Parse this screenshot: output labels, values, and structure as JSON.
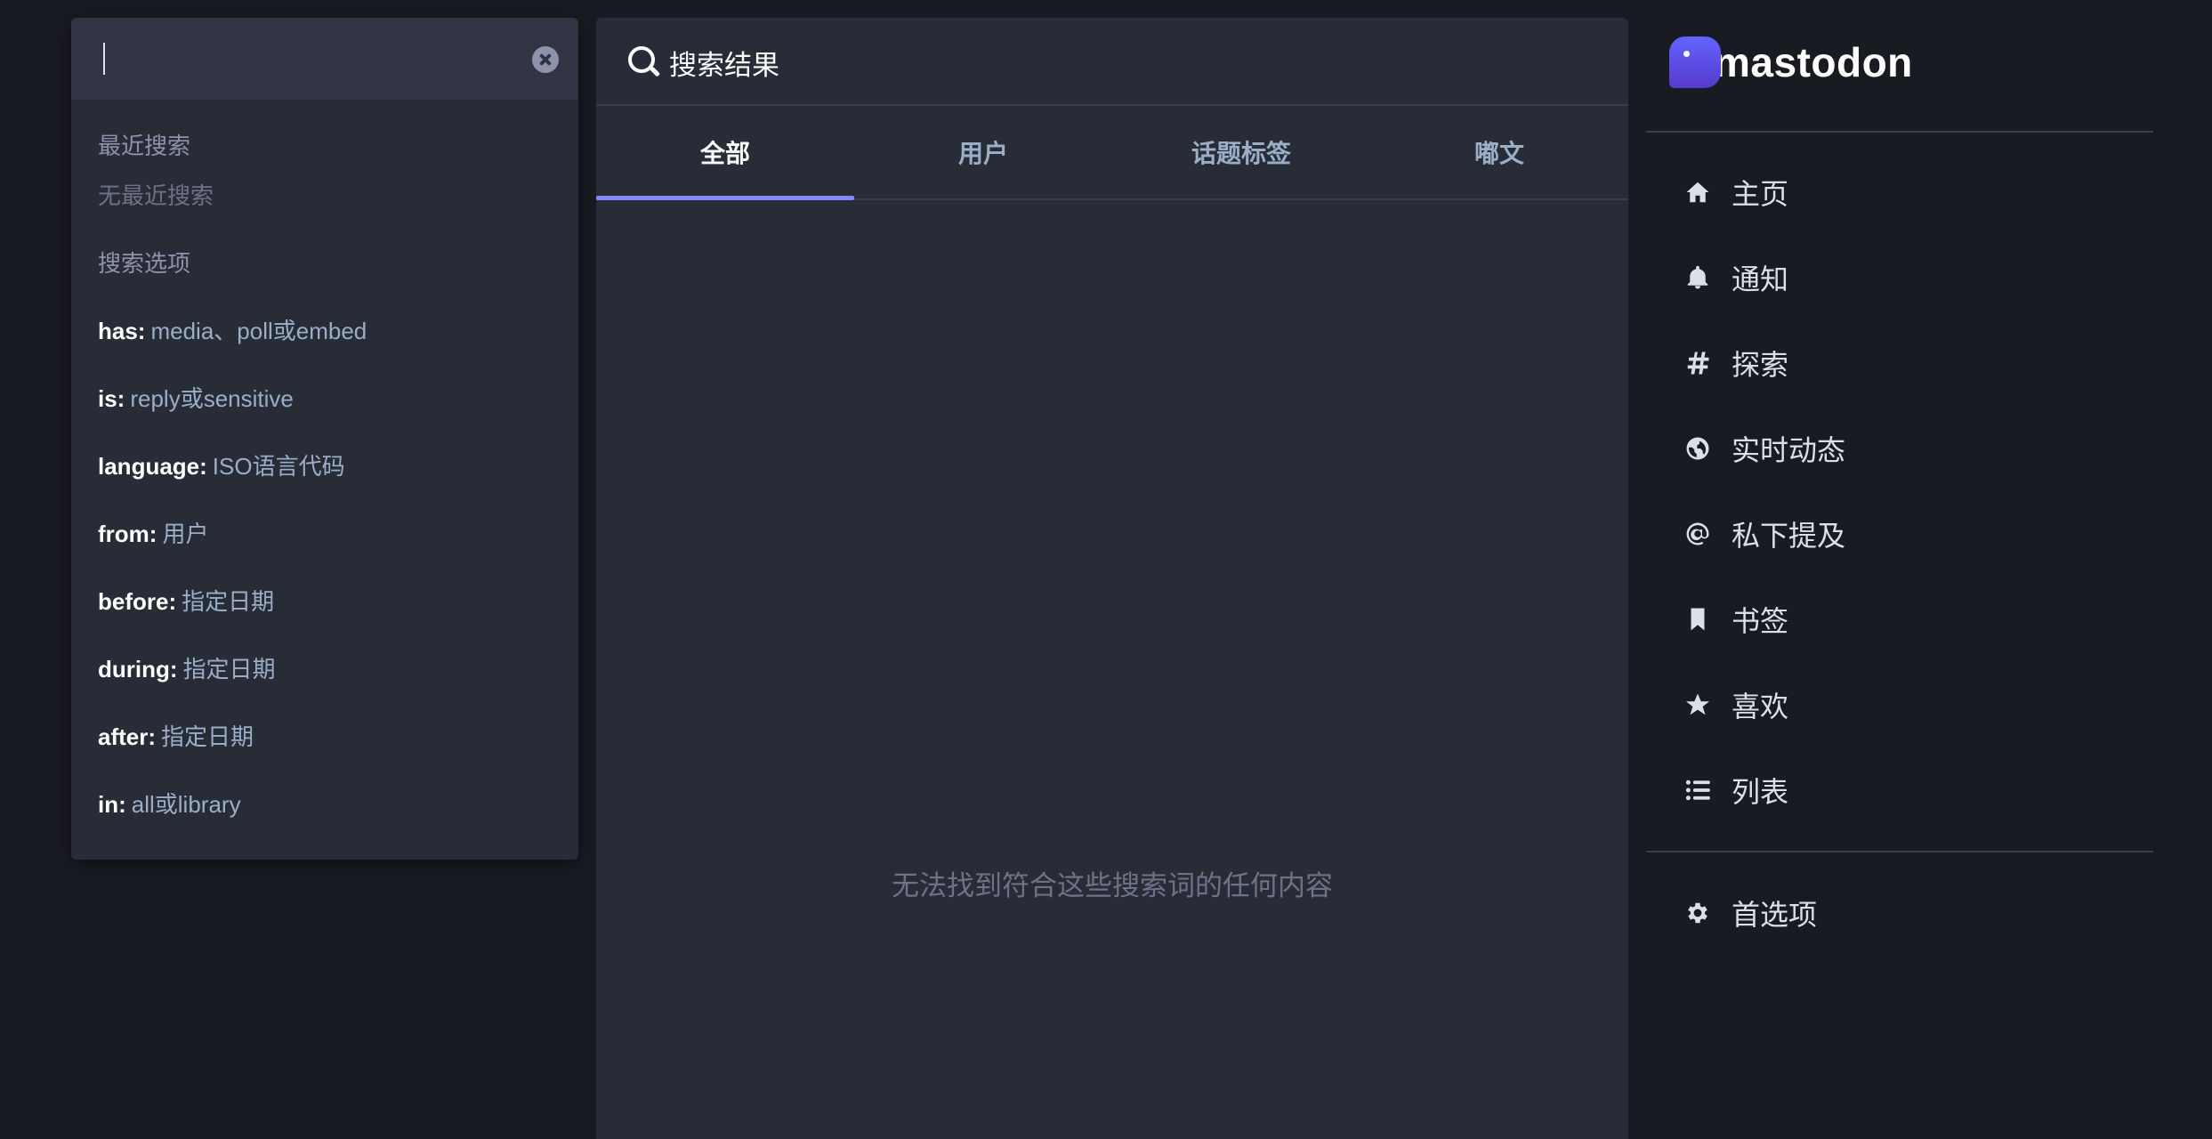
{
  "search": {
    "value": "",
    "recent_heading": "最近搜索",
    "recent_empty": "无最近搜索",
    "options_heading": "搜索选项",
    "options": [
      {
        "key": "has:",
        "desc": "media、poll或embed"
      },
      {
        "key": "is:",
        "desc": "reply或sensitive"
      },
      {
        "key": "language:",
        "desc": "ISO语言代码"
      },
      {
        "key": "from:",
        "desc": "用户"
      },
      {
        "key": "before:",
        "desc": "指定日期"
      },
      {
        "key": "during:",
        "desc": "指定日期"
      },
      {
        "key": "after:",
        "desc": "指定日期"
      },
      {
        "key": "in:",
        "desc": "all或library"
      }
    ]
  },
  "results": {
    "title": "搜索结果",
    "tabs": [
      {
        "label": "全部",
        "active": true
      },
      {
        "label": "用户",
        "active": false
      },
      {
        "label": "话题标签",
        "active": false
      },
      {
        "label": "嘟文",
        "active": false
      }
    ],
    "empty_message": "无法找到符合这些搜索词的任何内容"
  },
  "sidebar": {
    "logo_text": "mastodon",
    "items": [
      {
        "label": "主页",
        "icon": "home-icon"
      },
      {
        "label": "通知",
        "icon": "bell-icon"
      },
      {
        "label": "探索",
        "icon": "hashtag-icon"
      },
      {
        "label": "实时动态",
        "icon": "globe-icon"
      },
      {
        "label": "私下提及",
        "icon": "at-icon"
      },
      {
        "label": "书签",
        "icon": "bookmark-icon"
      },
      {
        "label": "喜欢",
        "icon": "star-icon"
      },
      {
        "label": "列表",
        "icon": "list-icon"
      }
    ],
    "preferences": {
      "label": "首选项",
      "icon": "gear-icon"
    }
  },
  "colors": {
    "background": "#191b22",
    "panel": "#282c37",
    "accent": "#858afa"
  }
}
